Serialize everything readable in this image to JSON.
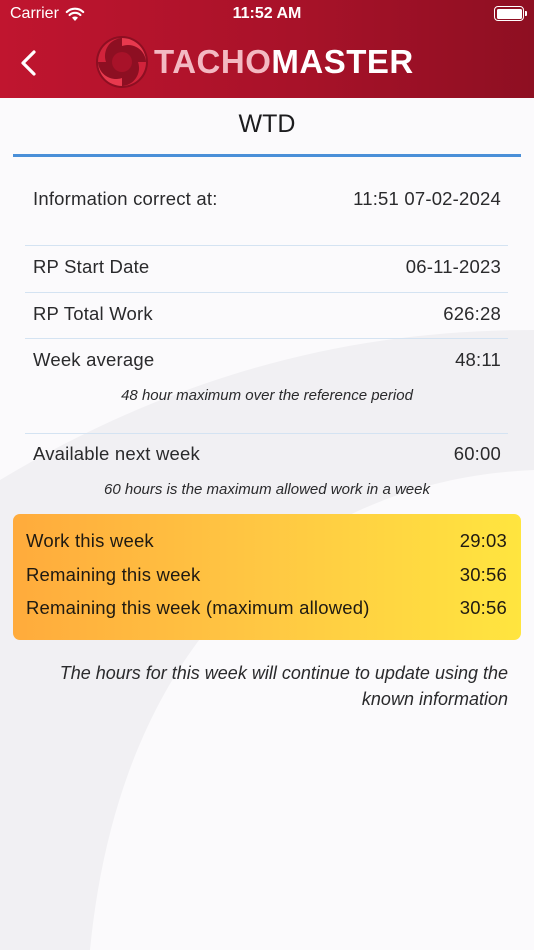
{
  "status_bar": {
    "carrier": "Carrier",
    "time": "11:52 AM"
  },
  "header": {
    "logo_text_light": "TACHO",
    "logo_text_bold": "MASTER",
    "back_icon": "chevron-left-icon"
  },
  "page": {
    "title": "WTD"
  },
  "info": {
    "label": "Information correct at:",
    "value": "11:51 07-02-2024"
  },
  "rows": [
    {
      "label": "RP Start Date",
      "value": "06-11-2023"
    },
    {
      "label": "RP Total Work",
      "value": "626:28"
    },
    {
      "label": "Week average",
      "value": "48:11"
    }
  ],
  "week_average_note": "48 hour maximum over the reference period",
  "available": {
    "label": "Available next week",
    "value": "60:00",
    "note": "60 hours is the maximum allowed work in a week"
  },
  "summary": [
    {
      "label": "Work this week",
      "value": "29:03"
    },
    {
      "label": "Remaining this week",
      "value": "30:56"
    },
    {
      "label": "Remaining this week (maximum allowed)",
      "value": "30:56"
    }
  ],
  "footer_note": "The hours for this week will continue to update using the known information",
  "colors": {
    "header": "#b0132b",
    "accent_rule": "#4a8fd8",
    "summary_start": "#ffab3c",
    "summary_end": "#ffe53f"
  }
}
